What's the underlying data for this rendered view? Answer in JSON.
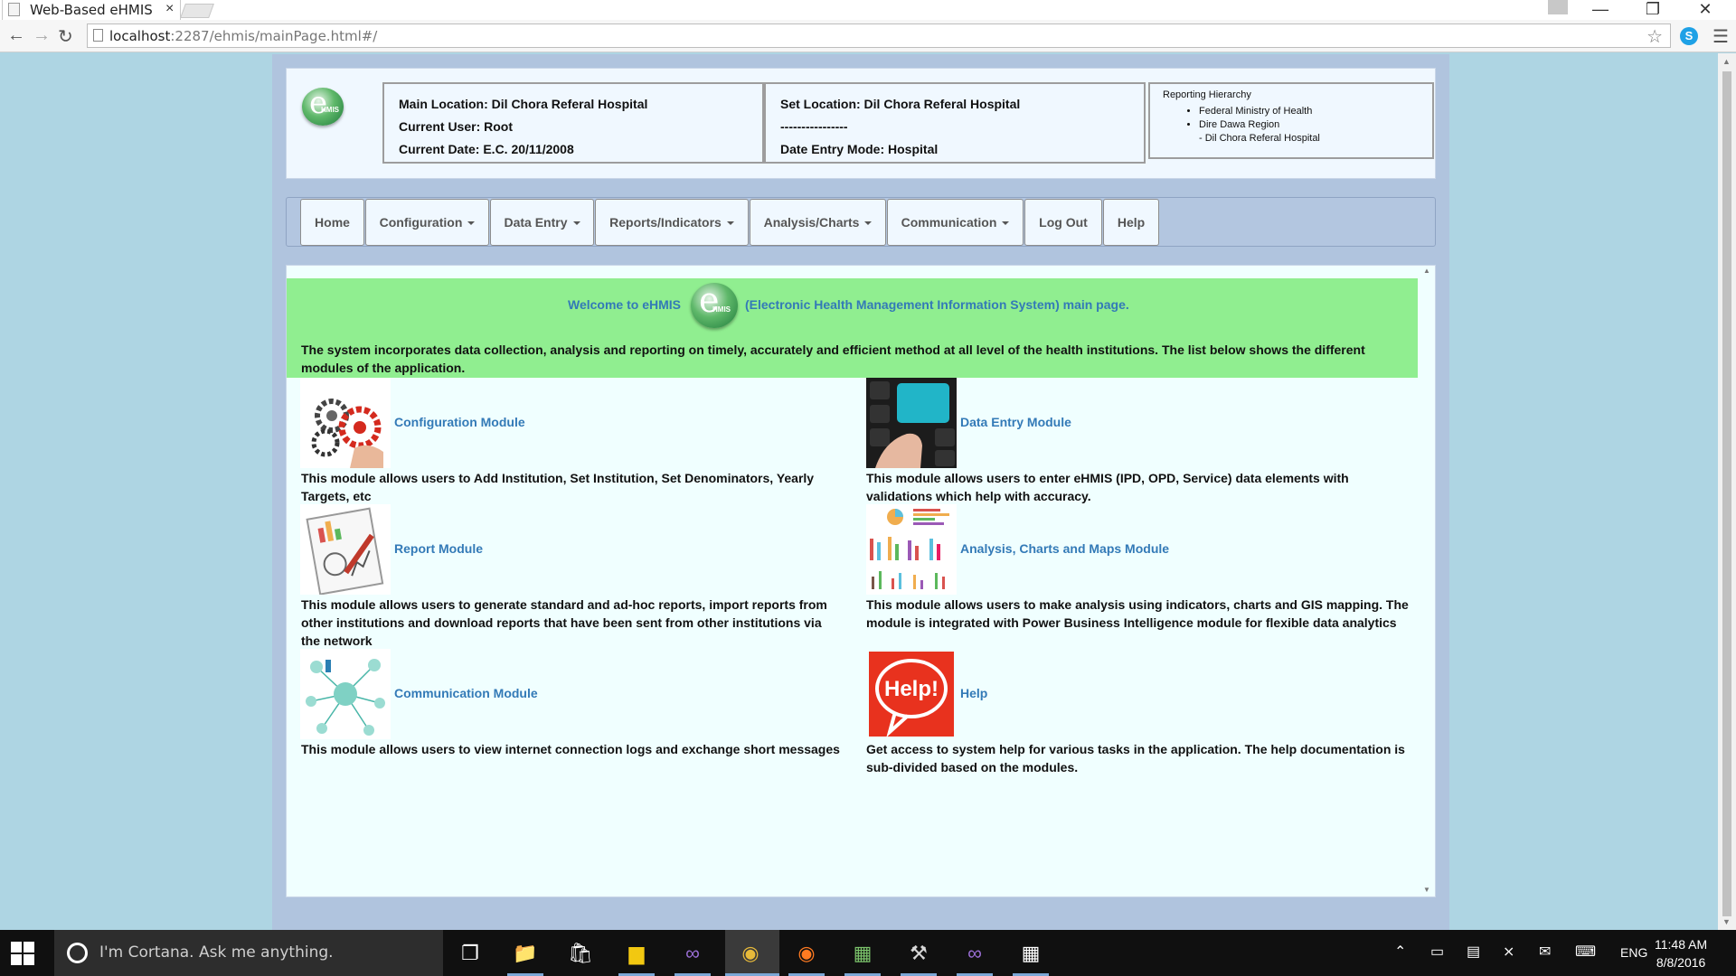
{
  "browser": {
    "tab_title": "Web-Based eHMIS",
    "tab_close": "×",
    "url_host": "localhost",
    "url_rest": ":2287/ehmis/mainPage.html#/"
  },
  "header": {
    "main_location": "Main Location: Dil Chora Referal Hospital",
    "current_user": "Current User: Root",
    "current_date": "Current Date: E.C. 20/11/2008",
    "set_location": "Set Location: Dil Chora Referal Hospital",
    "divider_text": "----------------",
    "date_entry_mode": "Date Entry Mode: Hospital",
    "hierarchy_title": "Reporting Hierarchy",
    "hierarchy_items": [
      "Federal Ministry of Health",
      "Dire Dawa Region"
    ],
    "hierarchy_sub": "- Dil Chora Referal Hospital"
  },
  "nav": {
    "home": "Home",
    "configuration": "Configuration",
    "data_entry": "Data Entry",
    "reports": "Reports/Indicators",
    "analysis": "Analysis/Charts",
    "communication": "Communication",
    "logout": "Log Out",
    "help": "Help"
  },
  "welcome": {
    "prefix": "Welcome to eHMIS",
    "suffix": "(Electronic Health Management Information System) main page.",
    "intro": "The system incorporates data collection, analysis and reporting on timely, accurately and efficient method at all level of the health institutions. The list below shows the different modules of the application."
  },
  "modules": {
    "configuration": {
      "title": "Configuration Module",
      "desc": "This module allows users to Add Institution, Set Institution, Set Denominators, Yearly Targets, etc"
    },
    "data_entry": {
      "title": "Data Entry Module",
      "desc": "This module allows users to enter eHMIS (IPD, OPD, Service) data elements with validations which help with accuracy."
    },
    "report": {
      "title": "Report Module",
      "desc": "This module allows users to generate standard and ad-hoc reports, import reports from other institutions and download reports that have been sent from other institutions via the network"
    },
    "analysis": {
      "title": "Analysis, Charts and Maps Module",
      "desc": "This module allows users to make analysis using indicators, charts and GIS mapping. The module is integrated with Power Business Intelligence module for flexible data analytics"
    },
    "communication": {
      "title": "Communication Module",
      "desc": "This module allows users to view internet connection logs and exchange short messages"
    },
    "help": {
      "title": "Help",
      "desc": "Get access to system help for various tasks in the application. The help documentation is sub-divided based on the modules.",
      "image_text": "Help!"
    }
  },
  "taskbar": {
    "cortana_placeholder": "I'm Cortana. Ask me anything.",
    "language": "ENG",
    "time": "11:48 AM",
    "date": "8/8/2016"
  },
  "colors": {
    "page_bg": "#aed5e3",
    "container_bg": "#b0c4de",
    "welcome_bg": "#90ee90",
    "link": "#337ab7",
    "panel_bg": "#f0f8ff",
    "help_red": "#e8321e"
  }
}
